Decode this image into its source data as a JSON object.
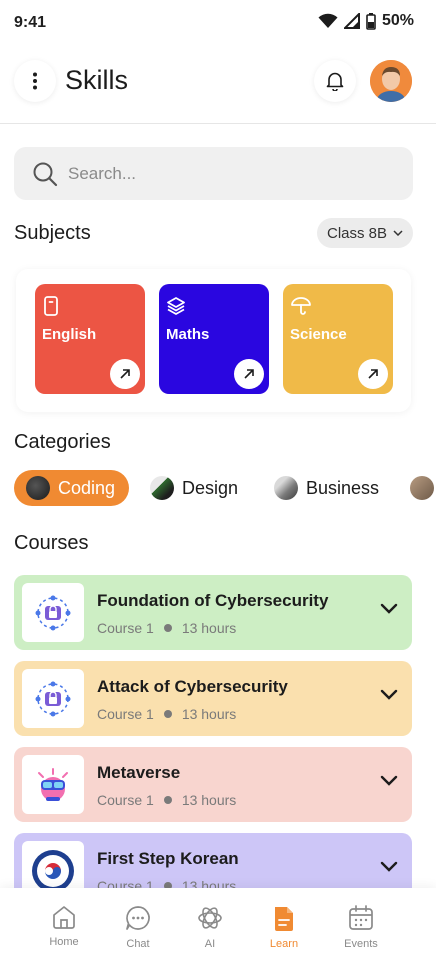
{
  "status_bar": {
    "time": "9:41",
    "battery": "50%"
  },
  "header": {
    "title": "Skills"
  },
  "search": {
    "placeholder": "Search..."
  },
  "subjects": {
    "title": "Subjects",
    "class_filter": "Class 8B",
    "items": [
      {
        "label": "English",
        "color": "#ec5544",
        "icon": "tablet-icon"
      },
      {
        "label": "Maths",
        "color": "#2a06e0",
        "icon": "layers-icon"
      },
      {
        "label": "Science",
        "color": "#f0ba48",
        "icon": "umbrella-icon"
      }
    ]
  },
  "categories": {
    "title": "Categories",
    "items": [
      {
        "label": "Coding",
        "active": true
      },
      {
        "label": "Design",
        "active": false
      },
      {
        "label": "Business",
        "active": false
      }
    ]
  },
  "courses": {
    "title": "Courses",
    "items": [
      {
        "title": "Foundation of Cybersecurity",
        "course": "Course 1",
        "duration": "13 hours",
        "color": "#cdeec4"
      },
      {
        "title": "Attack of Cybersecurity",
        "course": "Course 1",
        "duration": "13 hours",
        "color": "#fae0ae"
      },
      {
        "title": "Metaverse",
        "course": "Course 1",
        "duration": "13 hours",
        "color": "#f8d5cf"
      },
      {
        "title": "First Step Korean",
        "course": "Course 1",
        "duration": "13 hours",
        "color": "#cdc6f7"
      }
    ]
  },
  "bottom_nav": {
    "items": [
      {
        "label": "Home",
        "icon": "home-icon"
      },
      {
        "label": "Chat",
        "icon": "chat-icon"
      },
      {
        "label": "AI",
        "icon": "ai-icon"
      },
      {
        "label": "Learn",
        "icon": "learn-icon",
        "active": true
      },
      {
        "label": "Events",
        "icon": "calendar-icon"
      }
    ]
  },
  "colors": {
    "accent": "#f08a32"
  }
}
